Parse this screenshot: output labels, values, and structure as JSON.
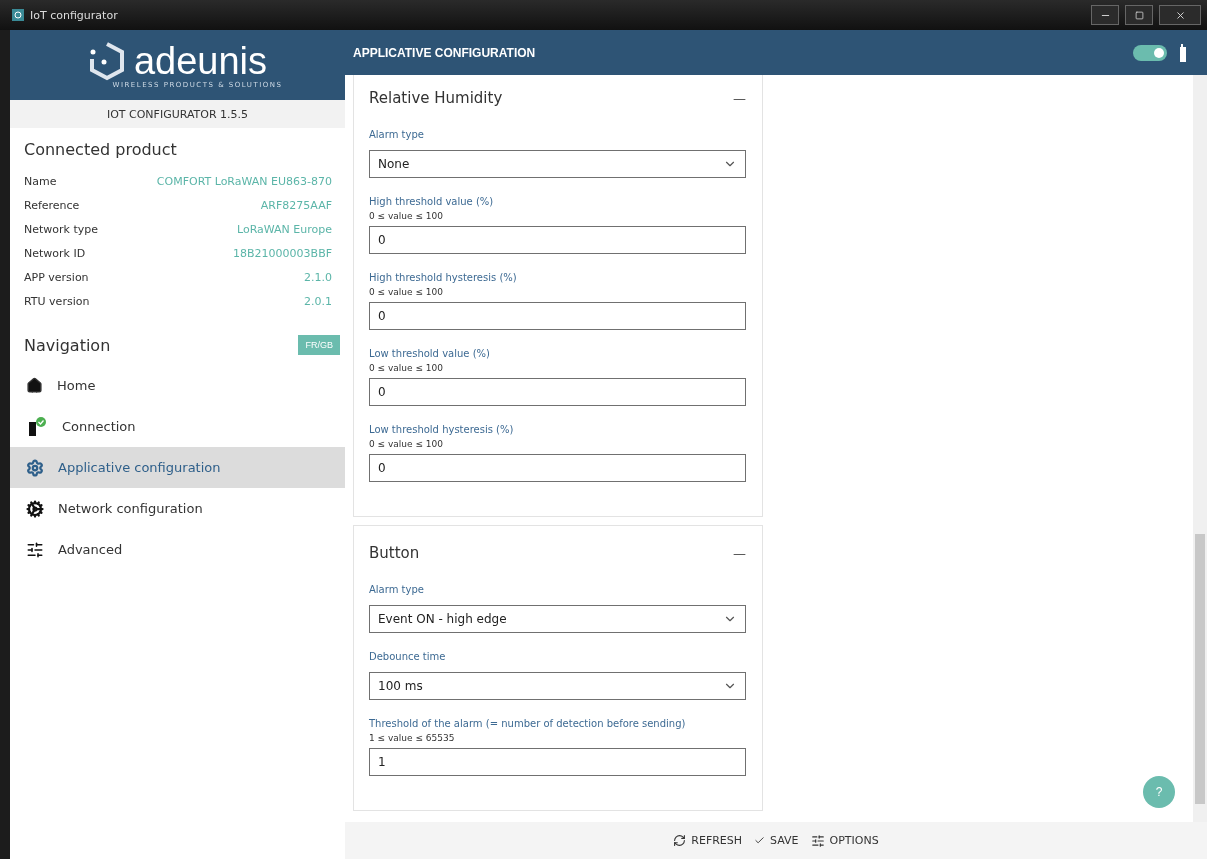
{
  "window": {
    "title": "IoT configurator"
  },
  "brand": {
    "name": "adeunis",
    "tagline": "WIRELESS PRODUCTS & SOLUTIONS",
    "version": "IOT CONFIGURATOR 1.5.5"
  },
  "header": {
    "title": "APPLICATIVE CONFIGURATION",
    "toggle": {
      "on": true
    }
  },
  "product": {
    "title": "Connected product",
    "rows": [
      {
        "label": "Name",
        "value": "COMFORT LoRaWAN EU863-870"
      },
      {
        "label": "Reference",
        "value": "ARF8275AAF"
      },
      {
        "label": "Network type",
        "value": "LoRaWAN Europe"
      },
      {
        "label": "Network ID",
        "value": "18B21000003BBF"
      },
      {
        "label": "APP version",
        "value": "2.1.0"
      },
      {
        "label": "RTU version",
        "value": "2.0.1"
      }
    ]
  },
  "navigation": {
    "title": "Navigation",
    "language": "FR/GB",
    "items": [
      {
        "label": "Home",
        "selected": false
      },
      {
        "label": "Connection",
        "selected": false
      },
      {
        "label": "Applicative configuration",
        "selected": true
      },
      {
        "label": "Network configuration",
        "selected": false
      },
      {
        "label": "Advanced",
        "selected": false
      }
    ]
  },
  "sections": [
    {
      "title": "Relative Humidity",
      "collapse": "—",
      "fields": [
        {
          "kind": "select",
          "label": "Alarm type",
          "value": "None"
        },
        {
          "kind": "input",
          "label": "High threshold value (%)",
          "hint": "0 ≤ value ≤ 100",
          "value": "0"
        },
        {
          "kind": "input",
          "label": "High threshold hysteresis (%)",
          "hint": "0 ≤ value ≤ 100",
          "value": "0"
        },
        {
          "kind": "input",
          "label": "Low threshold value (%)",
          "hint": "0 ≤ value ≤ 100",
          "value": "0"
        },
        {
          "kind": "input",
          "label": "Low threshold hysteresis (%)",
          "hint": "0 ≤ value ≤ 100",
          "value": "0"
        }
      ]
    },
    {
      "title": "Button",
      "collapse": "—",
      "fields": [
        {
          "kind": "select",
          "label": "Alarm type",
          "value": "Event ON - high edge"
        },
        {
          "kind": "select",
          "label": "Debounce time",
          "value": "100 ms"
        },
        {
          "kind": "input",
          "label": "Threshold of the alarm (= number of detection before sending)",
          "hint": "1 ≤ value ≤ 65535",
          "value": "1"
        }
      ]
    }
  ],
  "help": "?",
  "footer": [
    {
      "label": "REFRESH"
    },
    {
      "label": "SAVE"
    },
    {
      "label": "OPTIONS"
    }
  ]
}
